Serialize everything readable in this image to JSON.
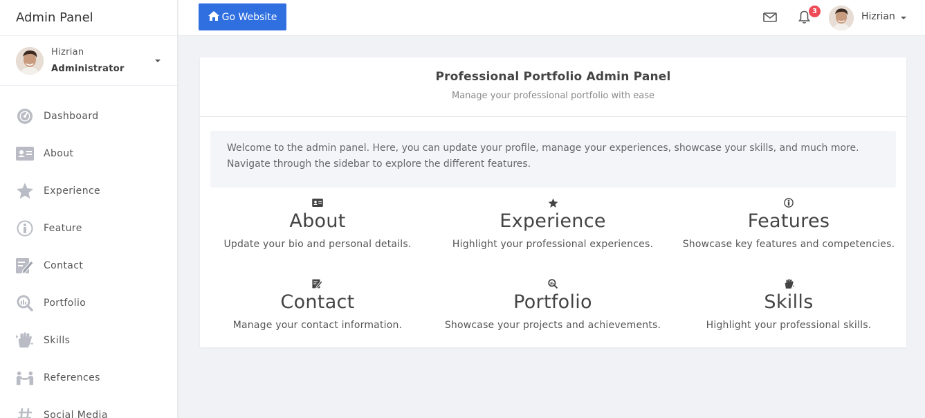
{
  "brand": {
    "title": "Admin Panel"
  },
  "sidebar": {
    "user": {
      "name": "Hizrian",
      "role": "Administrator"
    },
    "items": [
      {
        "label": "Dashboard",
        "icon": "dashboard-gauge-icon"
      },
      {
        "label": "About",
        "icon": "id-card-icon"
      },
      {
        "label": "Experience",
        "icon": "star-icon"
      },
      {
        "label": "Feature",
        "icon": "info-circle-icon"
      },
      {
        "label": "Contact",
        "icon": "edit-contact-icon"
      },
      {
        "label": "Portfolio",
        "icon": "search-chart-icon"
      },
      {
        "label": "Skills",
        "icon": "hand-sparkle-icon"
      },
      {
        "label": "References",
        "icon": "people-handshake-icon"
      },
      {
        "label": "Social Media",
        "icon": "hashtag-icon"
      }
    ]
  },
  "topbar": {
    "go_website_label": "Go Website",
    "notification_count": "3",
    "user_name": "Hizrian"
  },
  "main": {
    "title": "Professional Portfolio Admin Panel",
    "subtitle": "Manage your professional portfolio with ease",
    "welcome": "Welcome to the admin panel. Here, you can update your profile, manage your experiences, showcase your skills, and much more. Navigate through the sidebar to explore the different features.",
    "features": [
      {
        "title": "About",
        "description": "Update your bio and personal details.",
        "icon": "id-card-icon"
      },
      {
        "title": "Experience",
        "description": "Highlight your professional experiences.",
        "icon": "star-icon"
      },
      {
        "title": "Features",
        "description": "Showcase key features and competencies.",
        "icon": "info-circle-icon"
      },
      {
        "title": "Contact",
        "description": "Manage your contact information.",
        "icon": "edit-contact-icon"
      },
      {
        "title": "Portfolio",
        "description": "Showcase your projects and achievements.",
        "icon": "search-chart-icon"
      },
      {
        "title": "Skills",
        "description": "Highlight your professional skills.",
        "icon": "hand-sparkle-icon"
      }
    ]
  },
  "colors": {
    "primary_button": "#2f6fe0",
    "badge": "#ef4b57",
    "background": "#f1f2f6",
    "sidebar_icon": "#b9bcc4"
  }
}
